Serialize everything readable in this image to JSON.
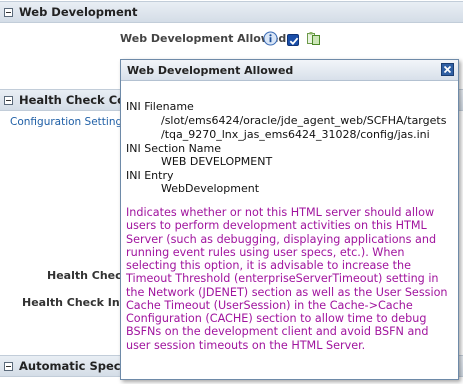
{
  "sections": {
    "web_development": {
      "title": "Web Development"
    },
    "health_check": {
      "title": "Health Check Conf"
    },
    "automatic_spec": {
      "title": "Automatic Spec G"
    }
  },
  "web_dev_setting": {
    "label": "Web Development Allowed",
    "checked": true
  },
  "config_link": "Configuration Settings fo",
  "health_labels": [
    "Health Check I",
    "Health Check Intera"
  ],
  "popup": {
    "title": "Web Development Allowed",
    "ini_filename_label": "INI Filename",
    "ini_filename_lines": [
      "/slot/ems6424/oracle/jde_agent_web/SCFHA/targets",
      "/tqa_9270_lnx_jas_ems6424_31028/config/jas.ini"
    ],
    "ini_section_label": "INI Section Name",
    "ini_section_value": "WEB DEVELOPMENT",
    "ini_entry_label": "INI Entry",
    "ini_entry_value": "WebDevelopment",
    "description": "Indicates whether or not this HTML server should allow users to perform development activities on this HTML Server (such as debugging, displaying applications and running event rules using user specs, etc.). When selecting this option, it is advisable to increase the Timeout Threshold (enterpriseServerTimeout) setting in the Network (JDENET) section as well as the User Session Cache Timeout (UserSession) in the Cache->Cache Configuration (CACHE) section to allow time to debug BSFNs on the development client and avoid BSFN and user session timeouts on the HTML Server."
  },
  "colors": {
    "description_text": "#a0149e",
    "link": "#1f5fa6",
    "header_bg": "#d4dde7"
  }
}
